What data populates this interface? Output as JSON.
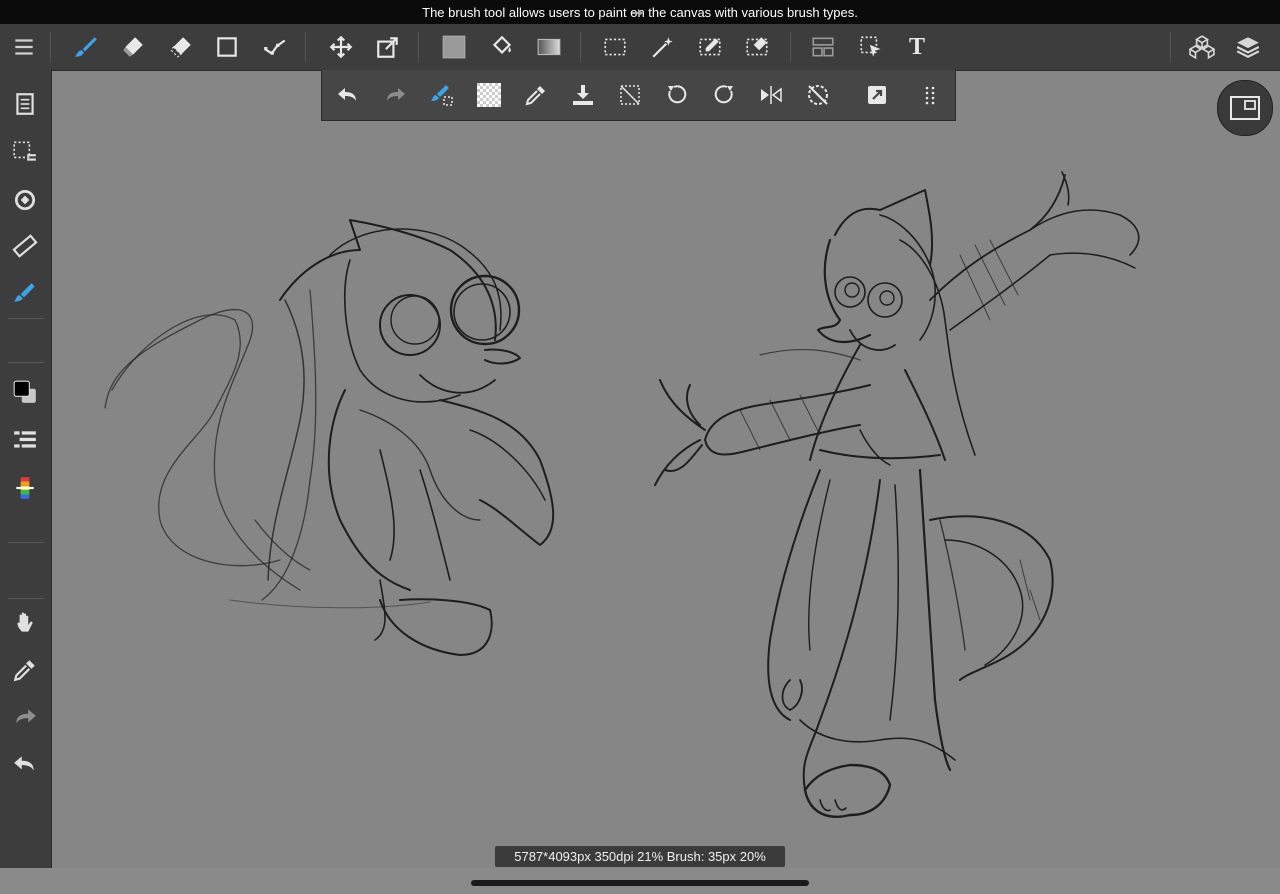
{
  "tooltip": {
    "text": "The brush tool allows users to paint on the canvas with various brush types."
  },
  "status": {
    "readout": "5787*4093px 350dpi 21% Brush: 35px 20%"
  },
  "colors": {
    "accent": "#3ea4e8",
    "toolbar_bg": "#3d3d3d",
    "canvas_bg": "#868686"
  },
  "topbar": {
    "text_tool_label": "T",
    "icons": [
      "menu-icon",
      "brush-icon",
      "eraser-icon",
      "soft-eraser-icon",
      "shape-icon",
      "lasso-icon",
      "move-icon",
      "transform-icon",
      "fill-swatch-icon",
      "bucket-icon",
      "gradient-icon",
      "marquee-icon",
      "magic-wand-icon",
      "select-pen-icon",
      "select-eraser-icon",
      "panel-icon",
      "select-layer-icon",
      "text-icon",
      "3d-icon",
      "layers-icon"
    ]
  },
  "sidebar": {
    "icons": [
      "pages-icon",
      "selection-list-icon",
      "rotate-canvas-icon",
      "ruler-icon",
      "brush-settings-icon",
      "color-swatch-icon",
      "layer-list-icon",
      "color-palette-icon",
      "hand-icon",
      "eyedropper-icon",
      "redo-icon",
      "undo-icon"
    ]
  },
  "subtoolbar": {
    "icons": [
      "undo-icon",
      "redo-icon",
      "brush-swap-icon",
      "transparent-icon",
      "eyedropper-icon",
      "import-icon",
      "deselect-icon",
      "rotate-left-icon",
      "rotate-right-icon",
      "flip-icon",
      "reset-rotation-icon",
      "snap-icon",
      "more-icon"
    ]
  }
}
